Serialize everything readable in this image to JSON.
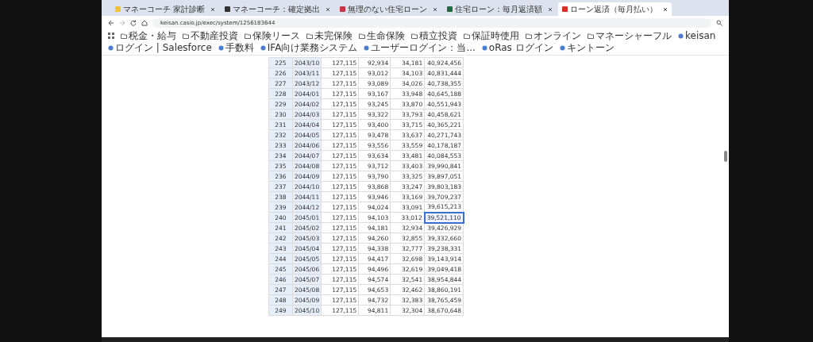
{
  "tabs": [
    {
      "title": "マネーコーチ 家計診断",
      "selected": false,
      "color": "#f2c230"
    },
    {
      "title": "マネーコーチ：確定拠出",
      "selected": false,
      "color": "#333333"
    },
    {
      "title": "無理のない住宅ローン",
      "selected": false,
      "color": "#c8344a"
    },
    {
      "title": "住宅ローン：毎月返済額",
      "selected": false,
      "color": "#1f6b3a"
    },
    {
      "title": "ローン返済（毎月払い）",
      "selected": true,
      "color": "#d9302c"
    }
  ],
  "address_bar": {
    "url": "keisan.casio.jp/exec/system/1256183644"
  },
  "bookmarks": [
    {
      "label": "税金・給与",
      "kind": "folder"
    },
    {
      "label": "不動産投資",
      "kind": "folder"
    },
    {
      "label": "保険リース",
      "kind": "folder"
    },
    {
      "label": "未完保険",
      "kind": "folder"
    },
    {
      "label": "生命保険",
      "kind": "folder"
    },
    {
      "label": "積立投資",
      "kind": "folder"
    },
    {
      "label": "保証時使用",
      "kind": "folder"
    },
    {
      "label": "オンライン",
      "kind": "folder"
    },
    {
      "label": "マネーシャーフル",
      "kind": "folder"
    },
    {
      "label": "keisan",
      "kind": "site"
    },
    {
      "label": "ログイン | Salesforce",
      "kind": "site"
    },
    {
      "label": "手数料",
      "kind": "site"
    },
    {
      "label": "IFA向け業務システム",
      "kind": "site"
    },
    {
      "label": "ユーザーログイン：当...",
      "kind": "site"
    },
    {
      "label": "oRas ログイン",
      "kind": "site"
    },
    {
      "label": "キントーン",
      "kind": "site"
    }
  ],
  "table": {
    "rows": [
      {
        "no": "225",
        "month": "2043/10",
        "payment": "127,115",
        "principal": "92,934",
        "interest": "34,181",
        "balance": "40,924,456",
        "selected": false
      },
      {
        "no": "226",
        "month": "2043/11",
        "payment": "127,115",
        "principal": "93,012",
        "interest": "34,103",
        "balance": "40,831,444",
        "selected": false
      },
      {
        "no": "227",
        "month": "2043/12",
        "payment": "127,115",
        "principal": "93,089",
        "interest": "34,026",
        "balance": "40,738,355",
        "selected": false
      },
      {
        "no": "228",
        "month": "2044/01",
        "payment": "127,115",
        "principal": "93,167",
        "interest": "33,948",
        "balance": "40,645,188",
        "selected": false
      },
      {
        "no": "229",
        "month": "2044/02",
        "payment": "127,115",
        "principal": "93,245",
        "interest": "33,870",
        "balance": "40,551,943",
        "selected": false
      },
      {
        "no": "230",
        "month": "2044/03",
        "payment": "127,115",
        "principal": "93,322",
        "interest": "33,793",
        "balance": "40,458,621",
        "selected": false
      },
      {
        "no": "231",
        "month": "2044/04",
        "payment": "127,115",
        "principal": "93,400",
        "interest": "33,715",
        "balance": "40,365,221",
        "selected": false
      },
      {
        "no": "232",
        "month": "2044/05",
        "payment": "127,115",
        "principal": "93,478",
        "interest": "33,637",
        "balance": "40,271,743",
        "selected": false
      },
      {
        "no": "233",
        "month": "2044/06",
        "payment": "127,115",
        "principal": "93,556",
        "interest": "33,559",
        "balance": "40,178,187",
        "selected": false
      },
      {
        "no": "234",
        "month": "2044/07",
        "payment": "127,115",
        "principal": "93,634",
        "interest": "33,481",
        "balance": "40,084,553",
        "selected": false
      },
      {
        "no": "235",
        "month": "2044/08",
        "payment": "127,115",
        "principal": "93,712",
        "interest": "33,403",
        "balance": "39,990,841",
        "selected": false
      },
      {
        "no": "236",
        "month": "2044/09",
        "payment": "127,115",
        "principal": "93,790",
        "interest": "33,325",
        "balance": "39,897,051",
        "selected": false
      },
      {
        "no": "237",
        "month": "2044/10",
        "payment": "127,115",
        "principal": "93,868",
        "interest": "33,247",
        "balance": "39,803,183",
        "selected": false
      },
      {
        "no": "238",
        "month": "2044/11",
        "payment": "127,115",
        "principal": "93,946",
        "interest": "33,169",
        "balance": "39,709,237",
        "selected": false
      },
      {
        "no": "239",
        "month": "2044/12",
        "payment": "127,115",
        "principal": "94,024",
        "interest": "33,091",
        "balance": "39,615,213",
        "selected": false
      },
      {
        "no": "240",
        "month": "2045/01",
        "payment": "127,115",
        "principal": "94,103",
        "interest": "33,012",
        "balance": "39,521,110",
        "selected": true
      },
      {
        "no": "241",
        "month": "2045/02",
        "payment": "127,115",
        "principal": "94,181",
        "interest": "32,934",
        "balance": "39,426,929",
        "selected": false
      },
      {
        "no": "242",
        "month": "2045/03",
        "payment": "127,115",
        "principal": "94,260",
        "interest": "32,855",
        "balance": "39,332,660",
        "selected": false
      },
      {
        "no": "243",
        "month": "2045/04",
        "payment": "127,115",
        "principal": "94,338",
        "interest": "32,777",
        "balance": "39,238,331",
        "selected": false
      },
      {
        "no": "244",
        "month": "2045/05",
        "payment": "127,115",
        "principal": "94,417",
        "interest": "32,698",
        "balance": "39,143,914",
        "selected": false
      },
      {
        "no": "245",
        "month": "2045/06",
        "payment": "127,115",
        "principal": "94,496",
        "interest": "32,619",
        "balance": "39,049,418",
        "selected": false
      },
      {
        "no": "246",
        "month": "2045/07",
        "payment": "127,115",
        "principal": "94,574",
        "interest": "32,541",
        "balance": "38,954,844",
        "selected": false
      },
      {
        "no": "247",
        "month": "2045/08",
        "payment": "127,115",
        "principal": "94,653",
        "interest": "32,462",
        "balance": "38,860,191",
        "selected": false
      },
      {
        "no": "248",
        "month": "2045/09",
        "payment": "127,115",
        "principal": "94,732",
        "interest": "32,383",
        "balance": "38,765,459",
        "selected": false
      },
      {
        "no": "249",
        "month": "2045/10",
        "payment": "127,115",
        "principal": "94,811",
        "interest": "32,304",
        "balance": "38,670,648",
        "selected": false
      }
    ]
  }
}
